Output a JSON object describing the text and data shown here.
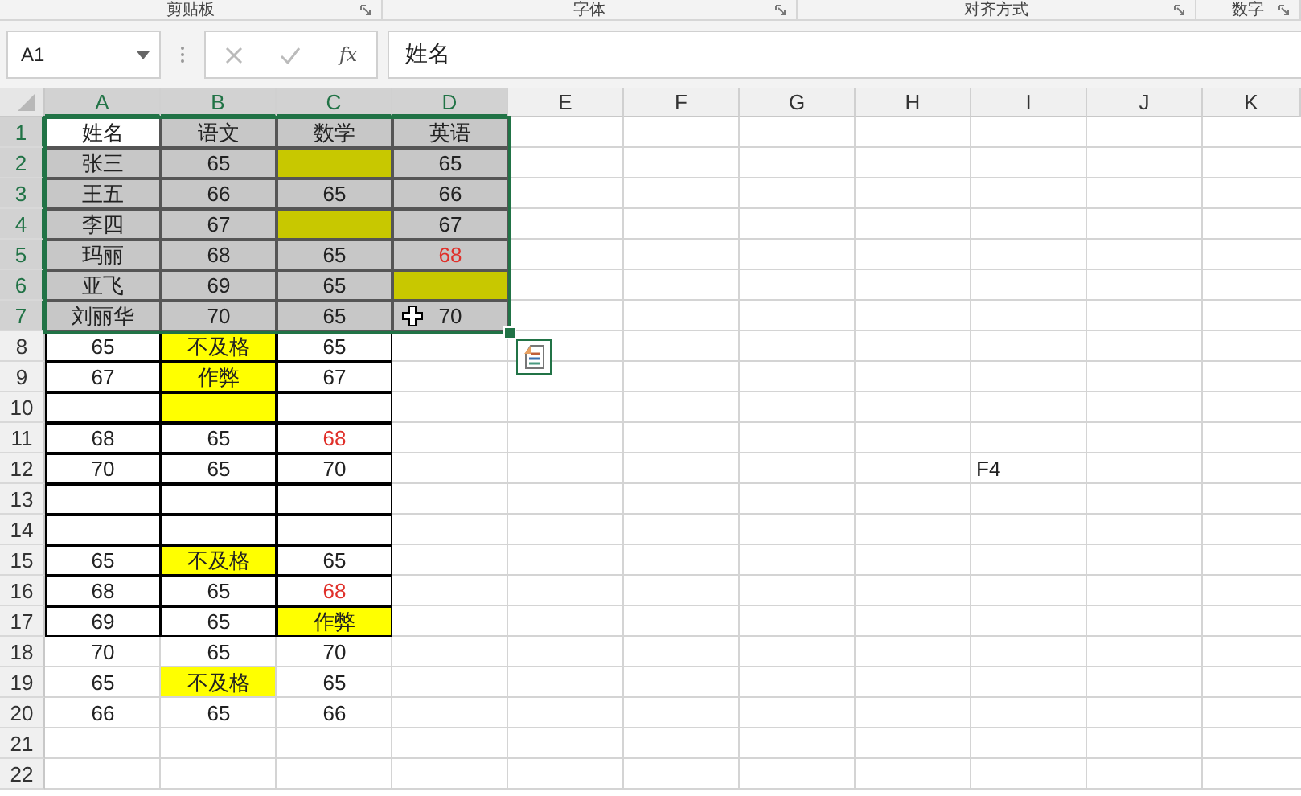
{
  "ribbon_groups": [
    {
      "label": "剪贴板"
    },
    {
      "label": "字体"
    },
    {
      "label": "对齐方式"
    },
    {
      "label": "数字"
    }
  ],
  "formula_bar": {
    "name_box": "A1",
    "function_label": "fx",
    "value": "姓名"
  },
  "columns": [
    {
      "label": "A",
      "selected": true
    },
    {
      "label": "B",
      "selected": true
    },
    {
      "label": "C",
      "selected": true
    },
    {
      "label": "D",
      "selected": true
    },
    {
      "label": "E",
      "selected": false
    },
    {
      "label": "F",
      "selected": false
    },
    {
      "label": "G",
      "selected": false
    },
    {
      "label": "H",
      "selected": false
    },
    {
      "label": "I",
      "selected": false
    },
    {
      "label": "J",
      "selected": false
    },
    {
      "label": "K",
      "selected": false
    }
  ],
  "rows": [
    {
      "label": "1",
      "selected": true,
      "cells": [
        {
          "text": "姓名",
          "selected": true,
          "bordered": true,
          "alert": false,
          "centered": true
        },
        {
          "text": "语文",
          "selected": true,
          "bordered": true,
          "alert": false,
          "centered": true
        },
        {
          "text": "数学",
          "selected": true,
          "bordered": true,
          "alert": false,
          "centered": true
        },
        {
          "text": "英语",
          "selected": true,
          "bordered": true,
          "alert": false,
          "centered": true
        }
      ]
    },
    {
      "label": "2",
      "selected": true,
      "cells": [
        {
          "text": "张三",
          "selected": true,
          "bordered": true,
          "alert": false,
          "centered": true
        },
        {
          "text": "65",
          "selected": true,
          "bordered": true,
          "alert": false,
          "centered": true
        },
        {
          "color": "#c8c800",
          "selected": true,
          "bordered": true
        },
        {
          "text": "65",
          "selected": true,
          "bordered": true,
          "alert": false,
          "centered": true
        }
      ]
    },
    {
      "label": "3",
      "selected": true,
      "cells": [
        {
          "text": "王五",
          "selected": true,
          "bordered": true,
          "alert": false,
          "centered": true
        },
        {
          "text": "66",
          "selected": true,
          "bordered": true,
          "alert": false,
          "centered": true
        },
        {
          "text": "65",
          "selected": true,
          "bordered": true,
          "alert": false,
          "centered": true
        },
        {
          "text": "66",
          "selected": true,
          "bordered": true,
          "alert": false,
          "centered": true
        }
      ]
    },
    {
      "label": "4",
      "selected": true,
      "cells": [
        {
          "text": "李四",
          "selected": true,
          "bordered": true,
          "alert": false,
          "centered": true
        },
        {
          "text": "67",
          "selected": true,
          "bordered": true,
          "alert": false,
          "centered": true
        },
        {
          "color": "#c8c800",
          "selected": true,
          "bordered": true
        },
        {
          "text": "67",
          "selected": true,
          "bordered": true,
          "alert": false,
          "centered": true
        }
      ]
    },
    {
      "label": "5",
      "selected": true,
      "cells": [
        {
          "text": "玛丽",
          "selected": true,
          "bordered": true,
          "alert": false,
          "centered": true
        },
        {
          "text": "68",
          "selected": true,
          "bordered": true,
          "alert": false,
          "centered": true
        },
        {
          "text": "65",
          "selected": true,
          "bordered": true,
          "alert": false,
          "centered": true
        },
        {
          "text": "68",
          "selected": true,
          "bordered": true,
          "alert": true,
          "centered": true
        }
      ]
    },
    {
      "label": "6",
      "selected": true,
      "cells": [
        {
          "text": "亚飞",
          "selected": true,
          "bordered": true,
          "alert": false,
          "centered": true
        },
        {
          "text": "69",
          "selected": true,
          "bordered": true,
          "alert": false,
          "centered": true
        },
        {
          "text": "65",
          "selected": true,
          "bordered": true,
          "alert": false,
          "centered": true
        },
        {
          "color": "#c8c800",
          "selected": true,
          "bordered": true
        }
      ]
    },
    {
      "label": "7",
      "selected": true,
      "cells": [
        {
          "text": "刘丽华",
          "selected": true,
          "bordered": true,
          "alert": false,
          "centered": true
        },
        {
          "text": "70",
          "selected": true,
          "bordered": true,
          "alert": false,
          "centered": true
        },
        {
          "text": "65",
          "selected": true,
          "bordered": true,
          "alert": false,
          "centered": true
        },
        {
          "text": "70",
          "selected": true,
          "bordered": true,
          "alert": false,
          "centered": true
        }
      ]
    },
    {
      "label": "8",
      "selected": false,
      "cells": [
        {
          "text": "65",
          "selected": false,
          "bordered": true,
          "alert": false,
          "centered": true
        },
        {
          "text": "不及格",
          "color": "#ffff00",
          "selected": false,
          "bordered": true,
          "alert": false,
          "centered": true
        },
        {
          "text": "65",
          "selected": false,
          "bordered": true,
          "alert": false,
          "centered": true
        }
      ]
    },
    {
      "label": "9",
      "selected": false,
      "cells": [
        {
          "text": "67",
          "selected": false,
          "bordered": true,
          "alert": false,
          "centered": true
        },
        {
          "text": "作弊",
          "color": "#ffff00",
          "selected": false,
          "bordered": true,
          "alert": false,
          "centered": true
        },
        {
          "text": "67",
          "selected": false,
          "bordered": true,
          "alert": false,
          "centered": true
        }
      ]
    },
    {
      "label": "10",
      "selected": false,
      "cells": [
        {
          "selected": false,
          "bordered": true
        },
        {
          "color": "#ffff00",
          "selected": false,
          "bordered": true
        },
        {
          "selected": false,
          "bordered": true
        }
      ]
    },
    {
      "label": "11",
      "selected": false,
      "cells": [
        {
          "text": "68",
          "selected": false,
          "bordered": true,
          "alert": false,
          "centered": true
        },
        {
          "text": "65",
          "selected": false,
          "bordered": true,
          "alert": false,
          "centered": true
        },
        {
          "text": "68",
          "selected": false,
          "bordered": true,
          "alert": true,
          "centered": true
        }
      ]
    },
    {
      "label": "12",
      "selected": false,
      "cells": [
        {
          "text": "70",
          "selected": false,
          "bordered": true,
          "alert": false,
          "centered": true
        },
        {
          "text": "65",
          "selected": false,
          "bordered": true,
          "alert": false,
          "centered": true
        },
        {
          "text": "70",
          "selected": false,
          "bordered": true,
          "alert": false,
          "centered": true
        },
        {},
        {},
        {},
        {},
        {},
        {
          "text": "F4",
          "selected": false,
          "bordered": false,
          "alert": false,
          "centered": false
        }
      ]
    },
    {
      "label": "13",
      "selected": false,
      "cells": [
        {
          "selected": false,
          "bordered": true
        },
        {
          "selected": false,
          "bordered": true
        },
        {
          "selected": false,
          "bordered": true
        }
      ]
    },
    {
      "label": "14",
      "selected": false,
      "cells": [
        {
          "selected": false,
          "bordered": true
        },
        {
          "selected": false,
          "bordered": true
        },
        {
          "selected": false,
          "bordered": true
        }
      ]
    },
    {
      "label": "15",
      "selected": false,
      "cells": [
        {
          "text": "65",
          "selected": false,
          "bordered": true,
          "alert": false,
          "centered": true
        },
        {
          "text": "不及格",
          "color": "#ffff00",
          "selected": false,
          "bordered": true,
          "alert": false,
          "centered": true
        },
        {
          "text": "65",
          "selected": false,
          "bordered": true,
          "alert": false,
          "centered": true
        }
      ]
    },
    {
      "label": "16",
      "selected": false,
      "cells": [
        {
          "text": "68",
          "selected": false,
          "bordered": true,
          "alert": false,
          "centered": true
        },
        {
          "text": "65",
          "selected": false,
          "bordered": true,
          "alert": false,
          "centered": true
        },
        {
          "text": "68",
          "selected": false,
          "bordered": true,
          "alert": true,
          "centered": true
        }
      ]
    },
    {
      "label": "17",
      "selected": false,
      "cells": [
        {
          "text": "69",
          "selected": false,
          "bordered": true,
          "alert": false,
          "centered": true
        },
        {
          "text": "65",
          "selected": false,
          "bordered": true,
          "alert": false,
          "centered": true
        },
        {
          "text": "作弊",
          "color": "#ffff00",
          "selected": false,
          "bordered": true,
          "alert": false,
          "centered": true
        }
      ]
    },
    {
      "label": "18",
      "selected": false,
      "cells": [
        {
          "text": "70",
          "selected": false,
          "bordered": false,
          "alert": false,
          "centered": true
        },
        {
          "text": "65",
          "selected": false,
          "bordered": false,
          "alert": false,
          "centered": true
        },
        {
          "text": "70",
          "selected": false,
          "bordered": false,
          "alert": false,
          "centered": true
        }
      ]
    },
    {
      "label": "19",
      "selected": false,
      "cells": [
        {
          "text": "65",
          "selected": false,
          "bordered": false,
          "alert": false,
          "centered": true
        },
        {
          "text": "不及格",
          "color": "#ffff00",
          "selected": false,
          "bordered": false,
          "alert": false,
          "centered": true
        },
        {
          "text": "65",
          "selected": false,
          "bordered": false,
          "alert": false,
          "centered": true
        }
      ]
    },
    {
      "label": "20",
      "selected": false,
      "cells": [
        {
          "text": "66",
          "selected": false,
          "bordered": false,
          "alert": false,
          "centered": true
        },
        {
          "text": "65",
          "selected": false,
          "bordered": false,
          "alert": false,
          "centered": true
        },
        {
          "text": "66",
          "selected": false,
          "bordered": false,
          "alert": false,
          "centered": true
        }
      ]
    },
    {
      "label": "21",
      "selected": false,
      "cells": []
    },
    {
      "label": "22",
      "selected": false,
      "cells": []
    }
  ]
}
